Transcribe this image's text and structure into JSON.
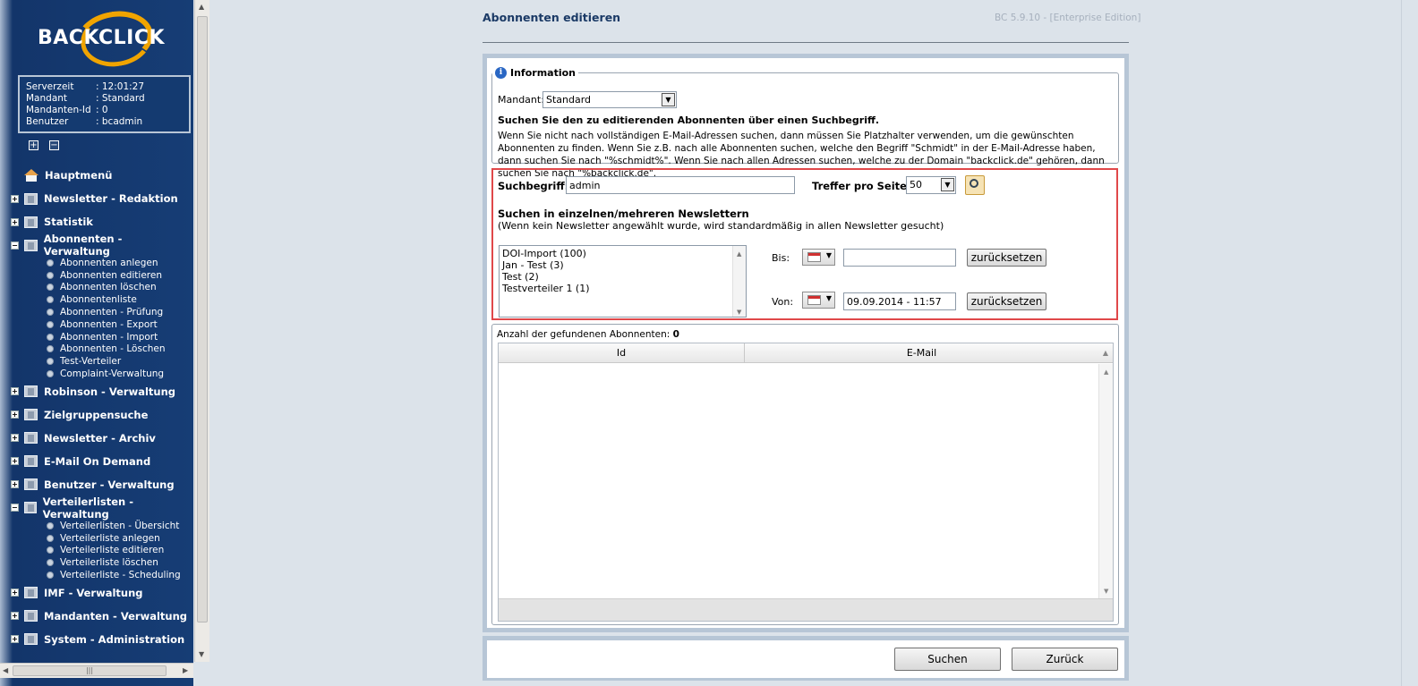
{
  "app": {
    "logo_text": "BACKCLICK"
  },
  "server_info": {
    "rows": [
      {
        "label": "Serverzeit",
        "value": ": 12:01:27"
      },
      {
        "label": "Mandant",
        "value": ": Standard"
      },
      {
        "label": "Mandanten-Id",
        "value": ": 0"
      },
      {
        "label": "Benutzer",
        "value": ": bcadmin"
      }
    ]
  },
  "tree_buttons": {
    "expand": "+",
    "collapse": "−"
  },
  "nav": {
    "home": "Hauptmenü",
    "newsletter_redaktion": "Newsletter - Redaktion",
    "statistik": "Statistik",
    "abonnenten_verwaltung": "Abonnenten - Verwaltung",
    "abonnenten_items": [
      "Abonnenten anlegen",
      "Abonnenten editieren",
      "Abonnenten löschen",
      "Abonnentenliste",
      "Abonnenten - Prüfung",
      "Abonnenten - Export",
      "Abonnenten - Import",
      "Abonnenten - Löschen",
      "Test-Verteiler",
      "Complaint-Verwaltung"
    ],
    "robinson": "Robinson - Verwaltung",
    "zielgruppensuche": "Zielgruppensuche",
    "newsletter_archiv": "Newsletter - Archiv",
    "email_on_demand": "E-Mail On Demand",
    "benutzer_verwaltung": "Benutzer - Verwaltung",
    "verteilerlisten_verwaltung": "Verteilerlisten - Verwaltung",
    "verteilerlisten_items": [
      "Verteilerlisten - Übersicht",
      "Verteilerliste anlegen",
      "Verteilerliste editieren",
      "Verteilerliste löschen",
      "Verteilerliste - Scheduling"
    ],
    "imf": "IMF - Verwaltung",
    "mandanten": "Mandanten - Verwaltung",
    "system": "System - Administration"
  },
  "page": {
    "title": "Abonnenten editieren",
    "version": "BC 5.9.10 - [Enterprise Edition]"
  },
  "info": {
    "legend": "Information",
    "mandant_label": "Mandant:",
    "mandant_value": "Standard",
    "heading": "Suchen Sie den zu editierenden Abonnenten über einen Suchbegriff.",
    "text": "Wenn Sie nicht nach vollständigen E-Mail-Adressen suchen, dann müssen Sie Platzhalter verwenden, um die gewünschten Abonnenten zu finden. Wenn Sie z.B. nach alle Abonnenten suchen, welche den Begriff \"Schmidt\" in der E-Mail-Adresse haben, dann suchen Sie nach \"%schmidt%\". Wenn Sie nach allen Adressen suchen, welche zu der Domain \"backclick.de\" gehören, dann suchen Sie nach \"%backclick.de\"."
  },
  "search": {
    "term_label": "Suchbegriff:",
    "term_value": "admin",
    "hits_label": "Treffer pro Seite:",
    "hits_value": "50",
    "nl_heading": "Suchen in einzelnen/mehreren Newslettern",
    "nl_hint": "(Wenn kein Newsletter angewählt wurde, wird standardmäßig in allen Newsletter gesucht)",
    "newsletters": [
      "DOI-Import (100)",
      "Jan - Test (3)",
      "Test (2)",
      "Testverteiler 1 (1)"
    ],
    "bis_label": "Bis:",
    "bis_value": "",
    "von_label": "Von:",
    "von_value": "09.09.2014 - 11:57",
    "reset_label": "zurücksetzen"
  },
  "results": {
    "count_label": "Anzahl der gefundenen Abonnenten:",
    "count_value": "0",
    "columns": [
      "Id",
      "E-Mail"
    ]
  },
  "actions": {
    "search": "Suchen",
    "back": "Zurück"
  }
}
